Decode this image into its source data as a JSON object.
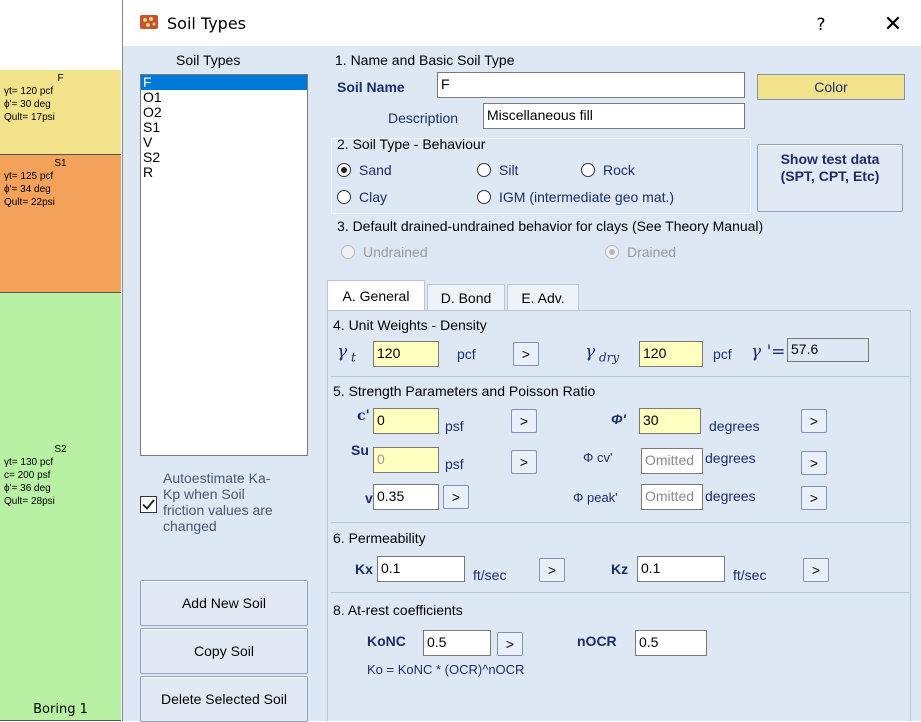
{
  "boring": {
    "layers": [
      {
        "name": "F",
        "lines": [
          "γt= 120 pcf",
          "ϕ'= 30 deg",
          "Qult= 17psi"
        ],
        "color": "#f2e28c"
      },
      {
        "name": "S1",
        "lines": [
          "γt= 125 pcf",
          "ϕ'= 34 deg",
          "Qult= 22psi"
        ],
        "color": "#f4a15a"
      },
      {
        "name": "S2",
        "lines": [
          "γt= 130 pcf",
          "c= 200 psf",
          "ϕ'= 36 deg",
          "Qult= 28psi"
        ],
        "color": "#b8f0a4"
      }
    ],
    "label": "Boring 1"
  },
  "window": {
    "title": "Soil Types",
    "help": "?",
    "close": "✕"
  },
  "soil_list": {
    "header": "Soil Types",
    "items": [
      "F",
      "O1",
      "O2",
      "S1",
      "V",
      "S2",
      "R"
    ],
    "selected": "F"
  },
  "autoestimate": {
    "label": "Autoestimate Ka-Kp when Soil friction values are changed",
    "checked": true
  },
  "buttons": {
    "add": "Add New Soil",
    "copy": "Copy Soil",
    "delete": "Delete Selected Soil",
    "color": "Color",
    "show_test": "Show test data (SPT, CPT, Etc)"
  },
  "section1": {
    "title": "1. Name and Basic Soil Type",
    "soil_name_label": "Soil Name",
    "soil_name_value": "F",
    "description_label": "Description",
    "description_value": "Miscellaneous fill"
  },
  "section2": {
    "title": "2. Soil Type - Behaviour",
    "options": [
      "Sand",
      "Silt",
      "Rock",
      "Clay",
      "IGM (intermediate geo mat.)"
    ],
    "selected": "Sand"
  },
  "section3": {
    "title": "3. Default drained-undrained behavior for clays (See Theory Manual)",
    "options": [
      "Undrained",
      "Drained"
    ],
    "selected": "Drained"
  },
  "tabs": [
    "A. General",
    "D. Bond",
    "E. Adv."
  ],
  "active_tab": "A. General",
  "unit_weights": {
    "title": "4. Unit Weights - Density",
    "gamma_t": "120",
    "gamma_t_unit": "pcf",
    "gamma_dry": "120",
    "gamma_dry_unit": "pcf",
    "gamma_prime": "57.6"
  },
  "strength": {
    "title": "5. Strength Parameters and Poisson Ratio",
    "c_label": "c'",
    "c_value": "0",
    "c_unit": "psf",
    "phi_label": "Φ'",
    "phi_value": "30",
    "phi_unit": "degrees",
    "su_label": "Su",
    "su_value": "0",
    "su_unit": "psf",
    "phicv_label": "Φ cv'",
    "phicv_value": "Omitted",
    "phicv_unit": "degrees",
    "v_label": "v",
    "v_value": "0.35",
    "phipeak_label": "Φ peak'",
    "phipeak_value": "Omitted",
    "phipeak_unit": "degrees"
  },
  "permeability": {
    "title": "6. Permeability",
    "kx_label": "Kx",
    "kx_value": "0.1",
    "kx_unit": "ft/sec",
    "kz_label": "Kz",
    "kz_value": "0.1",
    "kz_unit": "ft/sec"
  },
  "atrest": {
    "title": "8. At-rest coefficients",
    "konc_label": "KoNC",
    "konc_value": "0.5",
    "nocr_label": "nOCR",
    "nocr_value": "0.5",
    "formula": "Ko = KoNC * (OCR)^nOCR"
  },
  "arrow": ">"
}
